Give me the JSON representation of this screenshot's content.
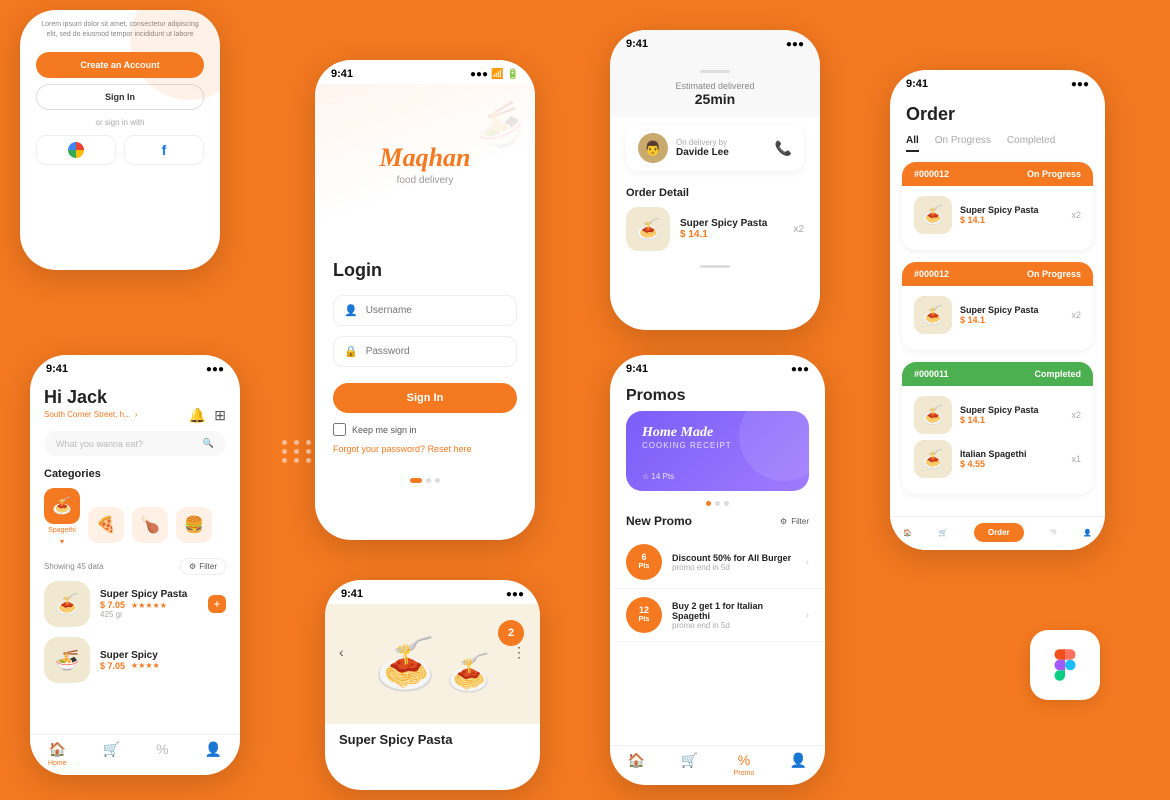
{
  "app": {
    "name": "Maqhan",
    "tagline": "food delivery",
    "time": "9:41"
  },
  "phone_signin": {
    "lorem": "Lorem ipsum dolor sit amet, consectetur adipiscing elit, sed do eiusmod tempor incididunt ut labore",
    "create_account": "Create an Account",
    "sign_in": "Sign In",
    "or_sign_in": "or sign in with"
  },
  "phone_login": {
    "title": "Login",
    "username_placeholder": "Username",
    "password_placeholder": "Password",
    "sign_in_btn": "Sign In",
    "keep_me": "Keep me sign in",
    "forgot_password": "Forgot your password?",
    "reset_here": "Reset here"
  },
  "phone_home": {
    "greeting": "Hi Jack",
    "location": "South Corner Street, h...",
    "search_placeholder": "What you wanna eat?",
    "categories_title": "Categories",
    "showing": "Showing 45 data",
    "filter": "Filter",
    "categories": [
      {
        "icon": "🍝",
        "label": "Spagethi",
        "active": true
      },
      {
        "icon": "🍕",
        "label": "Pizza",
        "active": false
      },
      {
        "icon": "🍗",
        "label": "Chicken",
        "active": false
      },
      {
        "icon": "🍔",
        "label": "Burger",
        "active": false
      }
    ],
    "foods": [
      {
        "name": "Super Spicy Pasta",
        "price": "$ 7.05",
        "stars": "★★★★★",
        "weight": "425 gr"
      },
      {
        "name": "Super Spicy",
        "price": "$ 7.05",
        "stars": "★★★★",
        "weight": ""
      }
    ],
    "nav": [
      {
        "icon": "🏠",
        "label": "Home",
        "active": true
      },
      {
        "icon": "🛒",
        "label": "Cart",
        "active": false
      },
      {
        "icon": "%",
        "label": "Promo",
        "active": false
      },
      {
        "icon": "👤",
        "label": "Profile",
        "active": false
      }
    ]
  },
  "phone_order_detail": {
    "est_delivery": "Estimated delivered",
    "est_time": "25min",
    "on_delivery_label": "On delivery by",
    "delivery_name": "Davide Lee",
    "order_detail_title": "Order Detail",
    "food_name": "Super Spicy Pasta",
    "food_price": "$ 14.1",
    "food_qty": "x2"
  },
  "phone_pasta_detail": {
    "title": "Super Spicy Pasta",
    "badge": "2"
  },
  "phone_promos": {
    "title": "Promos",
    "banner": {
      "line1": "Home Made",
      "line2": "COOKING RECEIPT",
      "pts": "14 Pts"
    },
    "new_promo_title": "New Promo",
    "filter": "Filter",
    "items": [
      {
        "pts": "6",
        "pts_label": "Pts",
        "name": "Discount 50% for All Burger",
        "end": "promo end in 5d"
      },
      {
        "pts": "12",
        "pts_label": "Pts",
        "name": "Buy 2 get 1 for Italian Spagethi",
        "end": "promo end in 5d"
      }
    ],
    "nav": [
      {
        "icon": "🏠",
        "label": "Home",
        "active": false
      },
      {
        "icon": "🛒",
        "label": "",
        "active": false
      },
      {
        "icon": "%",
        "label": "Promo",
        "active": true
      },
      {
        "icon": "👤",
        "label": "",
        "active": false
      }
    ]
  },
  "phone_order_list": {
    "title": "Order",
    "tabs": [
      "All",
      "On Progress",
      "Completed"
    ],
    "active_tab": "All",
    "orders": [
      {
        "id": "#000012",
        "status": "On Progress",
        "status_color": "orange",
        "items": [
          {
            "name": "Super Spicy Pasta",
            "price": "$ 14.1",
            "qty": "x2"
          }
        ]
      },
      {
        "id": "#000012",
        "status": "On Progress",
        "status_color": "orange",
        "items": [
          {
            "name": "Super Spicy Pasta",
            "price": "$ 14.1",
            "qty": "x2"
          }
        ]
      },
      {
        "id": "#000011",
        "status": "Completed",
        "status_color": "green",
        "items": [
          {
            "name": "Super Spicy Pasta",
            "price": "$ 14.1",
            "qty": "x2"
          },
          {
            "name": "Italian Spagethi",
            "price": "$ 4.55",
            "qty": "x1"
          }
        ]
      }
    ],
    "nav": [
      {
        "icon": "🏠",
        "label": "",
        "active": false
      },
      {
        "icon": "🛒",
        "label": "Order",
        "active": true
      },
      {
        "icon": "%",
        "label": "",
        "active": false
      },
      {
        "icon": "👤",
        "label": "",
        "active": false
      }
    ]
  }
}
